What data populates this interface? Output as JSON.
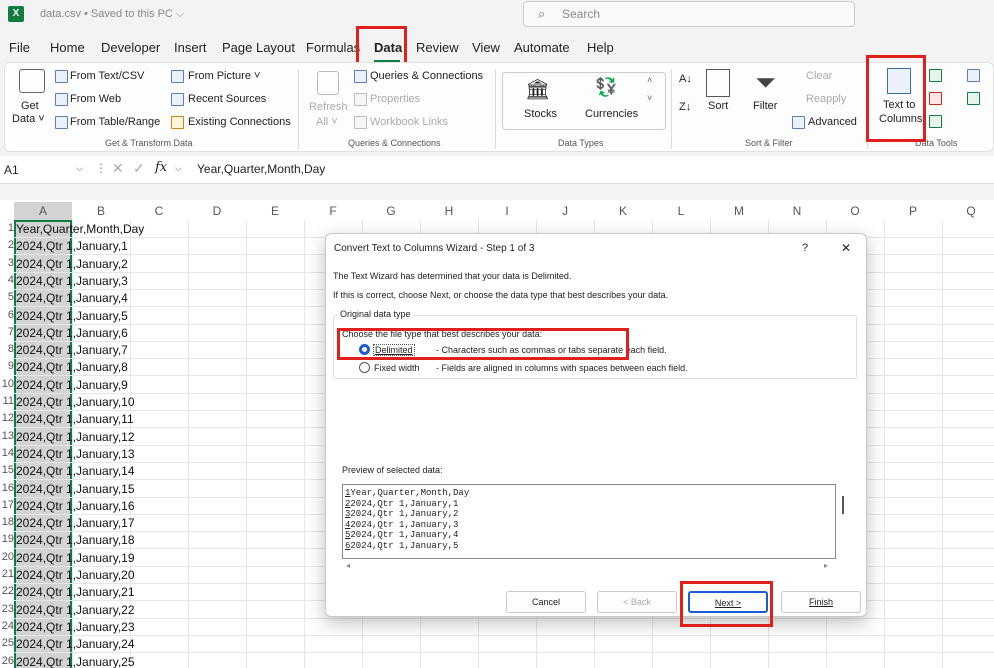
{
  "titlebar": {
    "logo": "X",
    "filename": "data.csv • Saved to this PC ⌵",
    "search_placeholder": "Search"
  },
  "menu": [
    "File",
    "Home",
    "Developer",
    "Insert",
    "Page Layout",
    "Formulas",
    "Data",
    "Review",
    "View",
    "Automate",
    "Help"
  ],
  "ribbon": {
    "get_data": "Get",
    "get_data_2": "Data ˅",
    "from_text_csv": "From Text/CSV",
    "from_web": "From Web",
    "from_table": "From Table/Range",
    "from_picture": "From Picture ˅",
    "recent_sources": "Recent Sources",
    "existing_connections": "Existing Connections",
    "group_get_transform": "Get & Transform Data",
    "refresh": "Refresh",
    "refresh_all": "All ˅",
    "queries_connections": "Queries & Connections",
    "properties": "Properties",
    "workbook_links": "Workbook Links",
    "group_queries": "Queries & Connections",
    "stocks": "Stocks",
    "currencies": "Currencies",
    "group_data_types": "Data Types",
    "sort": "Sort",
    "filter": "Filter",
    "clear": "Clear",
    "reapply": "Reapply",
    "advanced": "Advanced",
    "group_sort_filter": "Sort & Filter",
    "text_to": "Text to",
    "columns": "Columns",
    "group_data_tools": "Data Tools"
  },
  "formula_bar": {
    "name_box": "A1",
    "fx": "fx",
    "value": "Year,Quarter,Month,Day"
  },
  "columns": [
    "A",
    "B",
    "C",
    "D",
    "E",
    "F",
    "G",
    "H",
    "I",
    "J",
    "K",
    "L",
    "M",
    "N",
    "O",
    "P",
    "Q"
  ],
  "rows": [
    {
      "n": "1",
      "v": "Year,Quarter,Month,Day"
    },
    {
      "n": "2",
      "v": "2024,Qtr 1,January,1"
    },
    {
      "n": "3",
      "v": "2024,Qtr 1,January,2"
    },
    {
      "n": "4",
      "v": "2024,Qtr 1,January,3"
    },
    {
      "n": "5",
      "v": "2024,Qtr 1,January,4"
    },
    {
      "n": "6",
      "v": "2024,Qtr 1,January,5"
    },
    {
      "n": "7",
      "v": "2024,Qtr 1,January,6"
    },
    {
      "n": "8",
      "v": "2024,Qtr 1,January,7"
    },
    {
      "n": "9",
      "v": "2024,Qtr 1,January,8"
    },
    {
      "n": "10",
      "v": "2024,Qtr 1,January,9"
    },
    {
      "n": "11",
      "v": "2024,Qtr 1,January,10"
    },
    {
      "n": "12",
      "v": "2024,Qtr 1,January,11"
    },
    {
      "n": "13",
      "v": "2024,Qtr 1,January,12"
    },
    {
      "n": "14",
      "v": "2024,Qtr 1,January,13"
    },
    {
      "n": "15",
      "v": "2024,Qtr 1,January,14"
    },
    {
      "n": "16",
      "v": "2024,Qtr 1,January,15"
    },
    {
      "n": "17",
      "v": "2024,Qtr 1,January,16"
    },
    {
      "n": "18",
      "v": "2024,Qtr 1,January,17"
    },
    {
      "n": "19",
      "v": "2024,Qtr 1,January,18"
    },
    {
      "n": "20",
      "v": "2024,Qtr 1,January,19"
    },
    {
      "n": "21",
      "v": "2024,Qtr 1,January,20"
    },
    {
      "n": "22",
      "v": "2024,Qtr 1,January,21"
    },
    {
      "n": "23",
      "v": "2024,Qtr 1,January,22"
    },
    {
      "n": "24",
      "v": "2024,Qtr 1,January,23"
    },
    {
      "n": "25",
      "v": "2024,Qtr 1,January,24"
    },
    {
      "n": "26",
      "v": "2024,Qtr 1,January,25"
    }
  ],
  "dialog": {
    "title": "Convert Text to Columns Wizard - Step 1 of 3",
    "help": "?",
    "close": "✕",
    "intro1": "The Text Wizard has determined that your data is Delimited.",
    "intro2": "If this is correct, choose Next, or choose the data type that best describes your data.",
    "group_title": "Original data type",
    "choose_label": "Choose the file type that best describes your data:",
    "opt_delimited": "Delimited",
    "opt_delimited_desc": "- Characters such as commas or tabs separate each field.",
    "opt_fixed": "Fixed width",
    "opt_fixed_desc": "- Fields are aligned in columns with spaces between each field.",
    "selected": "Delimited",
    "preview_label": "Preview of selected data:",
    "preview_lines": [
      {
        "n": "1",
        "t": "Year,Quarter,Month,Day"
      },
      {
        "n": "2",
        "t": "2024,Qtr 1,January,1"
      },
      {
        "n": "3",
        "t": "2024,Qtr 1,January,2"
      },
      {
        "n": "4",
        "t": "2024,Qtr 1,January,3"
      },
      {
        "n": "5",
        "t": "2024,Qtr 1,January,4"
      },
      {
        "n": "6",
        "t": "2024,Qtr 1,January,5"
      }
    ],
    "cancel": "Cancel",
    "back": "< Back",
    "next": "Next >",
    "finish": "Finish"
  },
  "colors": {
    "accent": "#107c41",
    "highlight": "#e0201b"
  }
}
